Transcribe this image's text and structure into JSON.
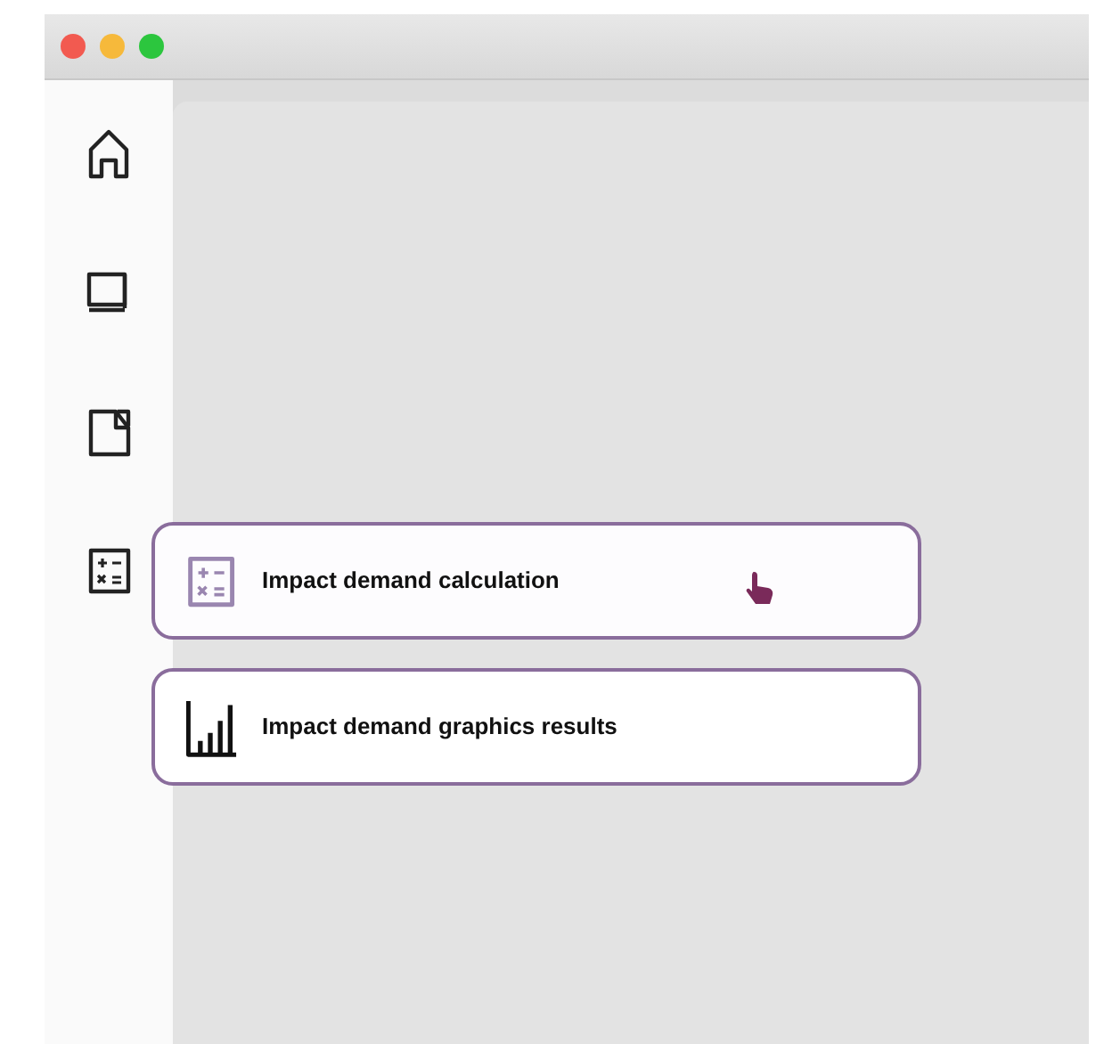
{
  "window": {
    "controls": [
      {
        "color": "#f25a50"
      },
      {
        "color": "#f6b93b"
      },
      {
        "color": "#2cc63e"
      }
    ]
  },
  "sidebar": {
    "items": [
      {
        "kind": "home"
      },
      {
        "kind": "monitor"
      },
      {
        "kind": "document"
      },
      {
        "kind": "calculator"
      }
    ]
  },
  "menu": [
    {
      "kind": "calculator",
      "label": "Impact demand calculation",
      "hovered": true
    },
    {
      "kind": "chart",
      "label": "Impact demand graphics results",
      "hovered": false
    }
  ]
}
